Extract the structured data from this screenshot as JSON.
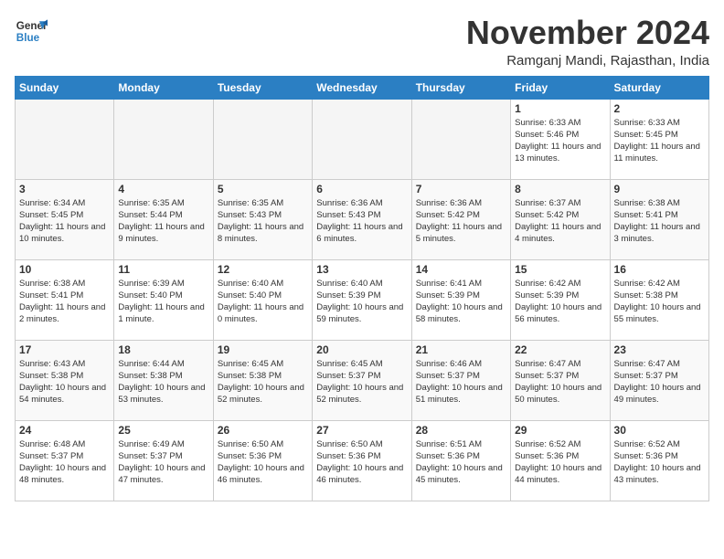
{
  "header": {
    "logo_line1": "General",
    "logo_line2": "Blue",
    "month_title": "November 2024",
    "subtitle": "Ramganj Mandi, Rajasthan, India"
  },
  "weekdays": [
    "Sunday",
    "Monday",
    "Tuesday",
    "Wednesday",
    "Thursday",
    "Friday",
    "Saturday"
  ],
  "weeks": [
    [
      {
        "day": "",
        "empty": true
      },
      {
        "day": "",
        "empty": true
      },
      {
        "day": "",
        "empty": true
      },
      {
        "day": "",
        "empty": true
      },
      {
        "day": "",
        "empty": true
      },
      {
        "day": "1",
        "sunrise": "Sunrise: 6:33 AM",
        "sunset": "Sunset: 5:46 PM",
        "daylight": "Daylight: 11 hours and 13 minutes."
      },
      {
        "day": "2",
        "sunrise": "Sunrise: 6:33 AM",
        "sunset": "Sunset: 5:45 PM",
        "daylight": "Daylight: 11 hours and 11 minutes."
      }
    ],
    [
      {
        "day": "3",
        "sunrise": "Sunrise: 6:34 AM",
        "sunset": "Sunset: 5:45 PM",
        "daylight": "Daylight: 11 hours and 10 minutes."
      },
      {
        "day": "4",
        "sunrise": "Sunrise: 6:35 AM",
        "sunset": "Sunset: 5:44 PM",
        "daylight": "Daylight: 11 hours and 9 minutes."
      },
      {
        "day": "5",
        "sunrise": "Sunrise: 6:35 AM",
        "sunset": "Sunset: 5:43 PM",
        "daylight": "Daylight: 11 hours and 8 minutes."
      },
      {
        "day": "6",
        "sunrise": "Sunrise: 6:36 AM",
        "sunset": "Sunset: 5:43 PM",
        "daylight": "Daylight: 11 hours and 6 minutes."
      },
      {
        "day": "7",
        "sunrise": "Sunrise: 6:36 AM",
        "sunset": "Sunset: 5:42 PM",
        "daylight": "Daylight: 11 hours and 5 minutes."
      },
      {
        "day": "8",
        "sunrise": "Sunrise: 6:37 AM",
        "sunset": "Sunset: 5:42 PM",
        "daylight": "Daylight: 11 hours and 4 minutes."
      },
      {
        "day": "9",
        "sunrise": "Sunrise: 6:38 AM",
        "sunset": "Sunset: 5:41 PM",
        "daylight": "Daylight: 11 hours and 3 minutes."
      }
    ],
    [
      {
        "day": "10",
        "sunrise": "Sunrise: 6:38 AM",
        "sunset": "Sunset: 5:41 PM",
        "daylight": "Daylight: 11 hours and 2 minutes."
      },
      {
        "day": "11",
        "sunrise": "Sunrise: 6:39 AM",
        "sunset": "Sunset: 5:40 PM",
        "daylight": "Daylight: 11 hours and 1 minute."
      },
      {
        "day": "12",
        "sunrise": "Sunrise: 6:40 AM",
        "sunset": "Sunset: 5:40 PM",
        "daylight": "Daylight: 11 hours and 0 minutes."
      },
      {
        "day": "13",
        "sunrise": "Sunrise: 6:40 AM",
        "sunset": "Sunset: 5:39 PM",
        "daylight": "Daylight: 10 hours and 59 minutes."
      },
      {
        "day": "14",
        "sunrise": "Sunrise: 6:41 AM",
        "sunset": "Sunset: 5:39 PM",
        "daylight": "Daylight: 10 hours and 58 minutes."
      },
      {
        "day": "15",
        "sunrise": "Sunrise: 6:42 AM",
        "sunset": "Sunset: 5:39 PM",
        "daylight": "Daylight: 10 hours and 56 minutes."
      },
      {
        "day": "16",
        "sunrise": "Sunrise: 6:42 AM",
        "sunset": "Sunset: 5:38 PM",
        "daylight": "Daylight: 10 hours and 55 minutes."
      }
    ],
    [
      {
        "day": "17",
        "sunrise": "Sunrise: 6:43 AM",
        "sunset": "Sunset: 5:38 PM",
        "daylight": "Daylight: 10 hours and 54 minutes."
      },
      {
        "day": "18",
        "sunrise": "Sunrise: 6:44 AM",
        "sunset": "Sunset: 5:38 PM",
        "daylight": "Daylight: 10 hours and 53 minutes."
      },
      {
        "day": "19",
        "sunrise": "Sunrise: 6:45 AM",
        "sunset": "Sunset: 5:38 PM",
        "daylight": "Daylight: 10 hours and 52 minutes."
      },
      {
        "day": "20",
        "sunrise": "Sunrise: 6:45 AM",
        "sunset": "Sunset: 5:37 PM",
        "daylight": "Daylight: 10 hours and 52 minutes."
      },
      {
        "day": "21",
        "sunrise": "Sunrise: 6:46 AM",
        "sunset": "Sunset: 5:37 PM",
        "daylight": "Daylight: 10 hours and 51 minutes."
      },
      {
        "day": "22",
        "sunrise": "Sunrise: 6:47 AM",
        "sunset": "Sunset: 5:37 PM",
        "daylight": "Daylight: 10 hours and 50 minutes."
      },
      {
        "day": "23",
        "sunrise": "Sunrise: 6:47 AM",
        "sunset": "Sunset: 5:37 PM",
        "daylight": "Daylight: 10 hours and 49 minutes."
      }
    ],
    [
      {
        "day": "24",
        "sunrise": "Sunrise: 6:48 AM",
        "sunset": "Sunset: 5:37 PM",
        "daylight": "Daylight: 10 hours and 48 minutes."
      },
      {
        "day": "25",
        "sunrise": "Sunrise: 6:49 AM",
        "sunset": "Sunset: 5:37 PM",
        "daylight": "Daylight: 10 hours and 47 minutes."
      },
      {
        "day": "26",
        "sunrise": "Sunrise: 6:50 AM",
        "sunset": "Sunset: 5:36 PM",
        "daylight": "Daylight: 10 hours and 46 minutes."
      },
      {
        "day": "27",
        "sunrise": "Sunrise: 6:50 AM",
        "sunset": "Sunset: 5:36 PM",
        "daylight": "Daylight: 10 hours and 46 minutes."
      },
      {
        "day": "28",
        "sunrise": "Sunrise: 6:51 AM",
        "sunset": "Sunset: 5:36 PM",
        "daylight": "Daylight: 10 hours and 45 minutes."
      },
      {
        "day": "29",
        "sunrise": "Sunrise: 6:52 AM",
        "sunset": "Sunset: 5:36 PM",
        "daylight": "Daylight: 10 hours and 44 minutes."
      },
      {
        "day": "30",
        "sunrise": "Sunrise: 6:52 AM",
        "sunset": "Sunset: 5:36 PM",
        "daylight": "Daylight: 10 hours and 43 minutes."
      }
    ]
  ]
}
